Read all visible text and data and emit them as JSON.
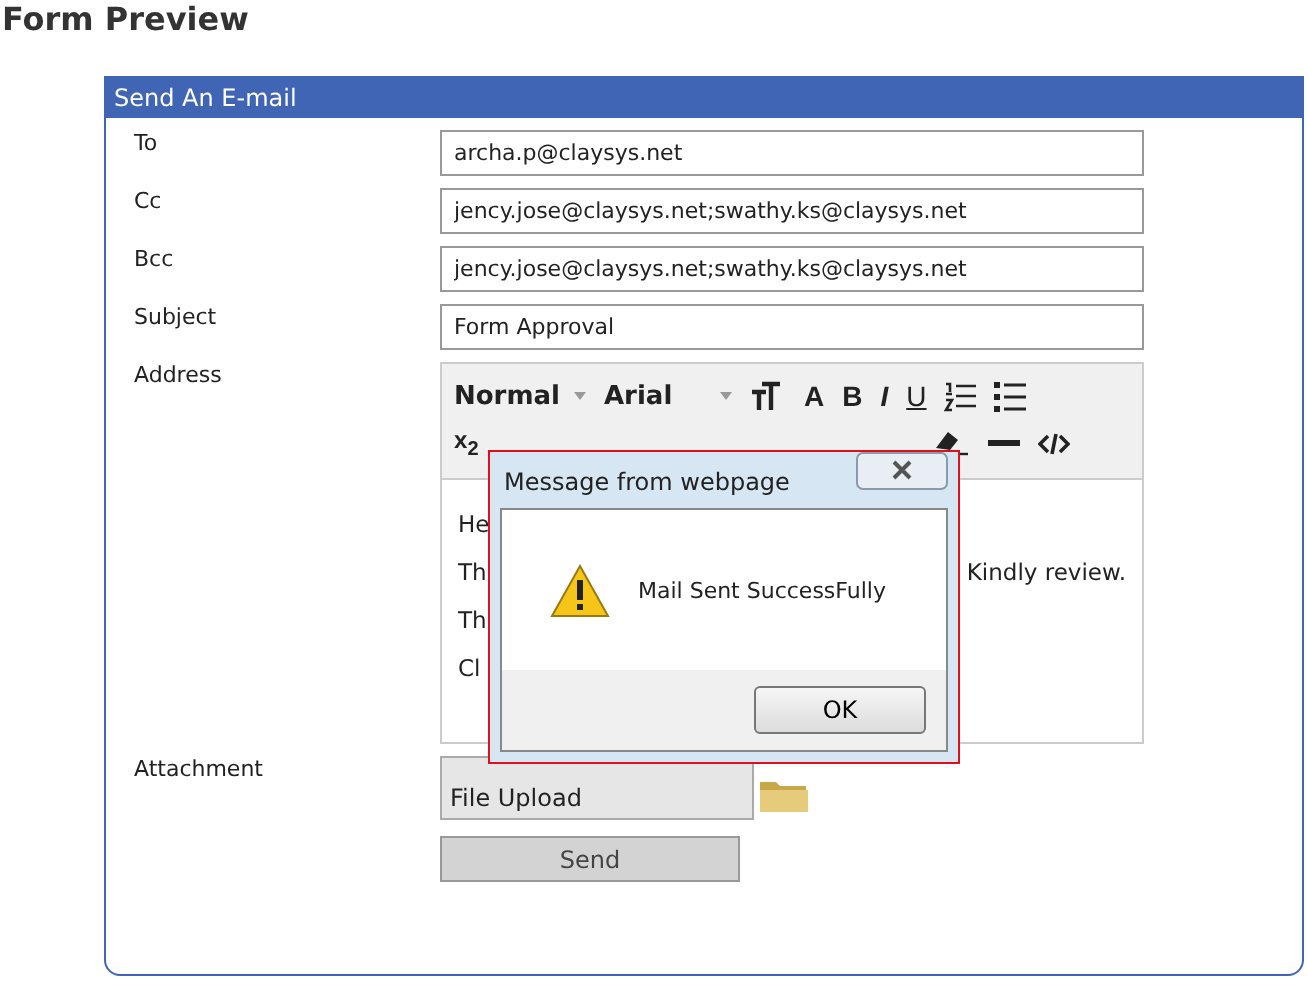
{
  "page_title": "Form Preview",
  "panel": {
    "title": "Send An E-mail",
    "fields": [
      {
        "label": "To",
        "value": "archa.p@claysys.net"
      },
      {
        "label": "Cc",
        "value": "jency.jose@claysys.net;swathy.ks@claysys.net"
      },
      {
        "label": "Bcc",
        "value": "jency.jose@claysys.net;swathy.ks@claysys.net"
      },
      {
        "label": "Subject",
        "value": "Form Approval"
      }
    ],
    "address": {
      "label": "Address",
      "toolbar": {
        "format": "Normal",
        "font": "Arial",
        "bold": "B",
        "italic": "I",
        "underline": "U",
        "font_color_glyph": "A",
        "subscript": "x$_{2}$"
      },
      "lines": [
        {
          "left": "He"
        },
        {
          "left": "Th",
          "right": "Kindly review."
        },
        {
          "left": "Th"
        },
        {
          "left": "Cl"
        }
      ]
    },
    "attachment": {
      "label": "Attachment",
      "button": "File Upload"
    },
    "send": "Send"
  },
  "dialog": {
    "title": "Message from webpage",
    "message": "Mail Sent SuccessFully",
    "ok": "OK"
  }
}
